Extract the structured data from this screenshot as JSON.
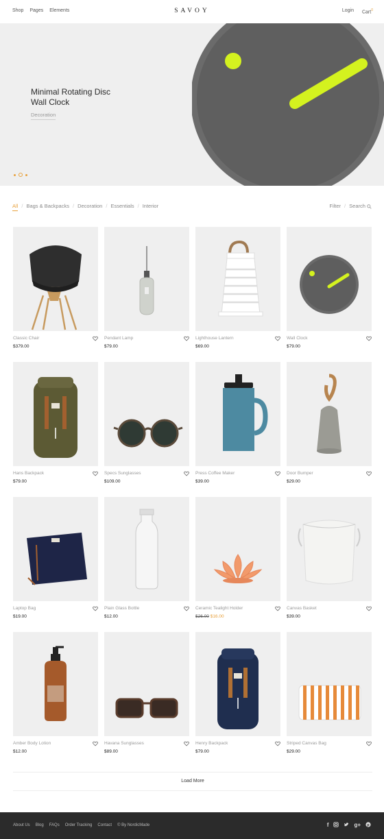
{
  "header": {
    "nav_left": [
      "Shop",
      "Pages",
      "Elements"
    ],
    "logo": "SAVOY",
    "login": "Login",
    "cart": "Cart",
    "cart_count": "0"
  },
  "hero": {
    "title_line1": "Minimal Rotating Disc",
    "title_line2": "Wall Clock",
    "subtitle": "Decoration",
    "slide_count": 3,
    "active_slide": 2
  },
  "filters": {
    "categories": [
      "All",
      "Bags & Backpacks",
      "Decoration",
      "Essentials",
      "Interior"
    ],
    "active": "All",
    "filter_label": "Filter",
    "search_label": "Search"
  },
  "products": [
    {
      "name": "Classic Chair",
      "price": "$379.00",
      "icon": "chair"
    },
    {
      "name": "Pendant Lamp",
      "price": "$79.00",
      "icon": "lamp"
    },
    {
      "name": "Lighthouse Lantern",
      "price": "$69.00",
      "icon": "lantern"
    },
    {
      "name": "Wall Clock",
      "price": "$79.00",
      "icon": "clock"
    },
    {
      "name": "Hans Backpack",
      "price": "$79.00",
      "icon": "backpack-green"
    },
    {
      "name": "Specs Sunglasses",
      "price": "$109.00",
      "icon": "sunglasses-round"
    },
    {
      "name": "Press Coffee Maker",
      "price": "$39.00",
      "icon": "coffee-press"
    },
    {
      "name": "Door Bumper",
      "price": "$29.00",
      "icon": "door-bumper"
    },
    {
      "name": "Laptop Bag",
      "price": "$19.00",
      "icon": "laptop-bag"
    },
    {
      "name": "Plain Glass Bottle",
      "price": "$12.00",
      "icon": "glass-bottle"
    },
    {
      "name": "Ceramic Tealight Holder",
      "price_old": "$26.00",
      "price_sale": "$16.00",
      "icon": "tealight"
    },
    {
      "name": "Canvas Basket",
      "price": "$39.00",
      "icon": "basket"
    },
    {
      "name": "Amber Body Lotion",
      "price": "$12.00",
      "icon": "lotion"
    },
    {
      "name": "Havana Sunglasses",
      "price": "$89.00",
      "icon": "sunglasses-square"
    },
    {
      "name": "Henry Backpack",
      "price": "$79.00",
      "icon": "backpack-navy"
    },
    {
      "name": "Striped Canvas Bag",
      "price": "$29.00",
      "icon": "striped-bag"
    }
  ],
  "load_more": "Load More",
  "footer": {
    "links": [
      "About Us",
      "Blog",
      "FAQs",
      "Order Tracking",
      "Contact"
    ],
    "credit": "© By NordicMade",
    "social": [
      "facebook-icon",
      "instagram-icon",
      "twitter-icon",
      "google-plus-icon",
      "pinterest-icon"
    ]
  },
  "colors": {
    "accent": "#e8a23e",
    "clock_hand": "#d4f21f",
    "footer_bg": "#2b2b2b",
    "tile_bg": "#efefef"
  }
}
